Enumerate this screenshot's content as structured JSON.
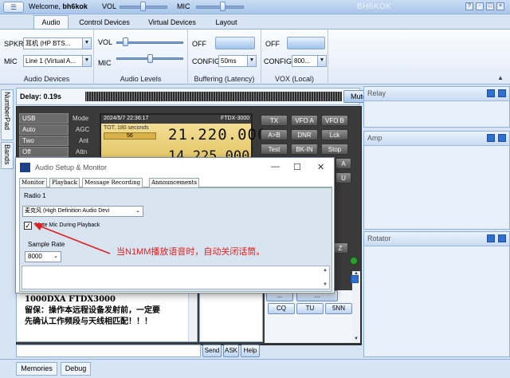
{
  "titlebar": {
    "menu_icon": "menu-icon",
    "welcome_prefix": "Welcome,",
    "user": "bh6kok",
    "vol_label": "VOL",
    "mic_label": "MIC",
    "app_title": "BH6KOK",
    "btn_help": "?",
    "btn_min": "-",
    "btn_max": "□",
    "btn_close": "×"
  },
  "tabs": [
    "Audio",
    "Control Devices",
    "Virtual Devices",
    "Layout"
  ],
  "ribbon": {
    "audio_devices": {
      "spkr_label": "SPKR",
      "spkr_value": "耳机 (HP BTS...",
      "mic_label": "MIC",
      "mic_value": "Line 1 (Virtual A...",
      "group": "Audio Devices"
    },
    "audio_levels": {
      "vol_label": "VOL",
      "mic_label": "MIC",
      "vol_level": 0.1,
      "mic_level": 0.5,
      "group": "Audio Levels"
    },
    "buffering": {
      "off_label": "OFF",
      "config_label": "CONFIG",
      "config_value": "50ms",
      "group": "Buffering (Latency)"
    },
    "vox": {
      "off_label": "OFF",
      "config_label": "CONFIG",
      "config_value": "800...",
      "group": "VOX (Local)"
    }
  },
  "sidebar": {
    "numberpad": "NumberPad",
    "bands": "Bands"
  },
  "delay": {
    "label": "Delay: 0.19s",
    "mute": "Mute"
  },
  "radio": {
    "left_buttons": [
      {
        "value": "USB",
        "label": "Mode"
      },
      {
        "value": "Auto",
        "label": "AGC"
      },
      {
        "value": "Two",
        "label": "Ant"
      },
      {
        "value": "Off",
        "label": "Attn"
      }
    ],
    "lcd": {
      "datetime": "2024/5/7 22:36:17",
      "model": "FTDX-3000",
      "tot": "TOT: 180 seconds",
      "tot_value": "56",
      "freq_main": "21.220.000",
      "freq_sub": "14.225.000"
    },
    "right_buttons": [
      [
        "TX",
        "VFO A",
        "VFO B"
      ],
      [
        "A>B",
        "DNR",
        "Lck"
      ],
      [
        "Test",
        "BK-IN",
        "Stop"
      ]
    ],
    "partial_right": [
      "A",
      "U"
    ],
    "z_label": "Z"
  },
  "bottom_text": {
    "line1": "1000DXA FTDX3000",
    "line2": "留保：操作本远程设备发射前，一定要",
    "line3": "先确认工作频段与天线相匹配！！！"
  },
  "cmd_buttons": {
    "partial_a": "...",
    "partial_b": "...",
    "cq": "CQ",
    "tu": "TU",
    "nn": "5NN"
  },
  "input_row": {
    "send": "Send",
    "ask": "ASK",
    "help": "Help"
  },
  "right_panels": [
    "Relay",
    "Amp",
    "Rotator"
  ],
  "bottom_tabs": [
    "Memories",
    "Debug"
  ],
  "dialog": {
    "title": "Audio Setup & Monitor",
    "min": "—",
    "max": "☐",
    "close": "✕",
    "tabs": [
      "Monitor",
      "Playback",
      "Message Recording",
      "Announcements"
    ],
    "radio_label": "Radio 1",
    "device_value": "麦克风 (High Definition Audio Devi",
    "checkbox_label": "Mute Mic During Playback",
    "checkbox_checked": true,
    "sample_rate_label": "Sample Rate",
    "sample_rate_value": "8000"
  },
  "annotation": "当N1MM播放语音时，自动关闭话筒。",
  "colors": {
    "annotation": "#e02020",
    "accent": "#2f6fd0",
    "lcd": "#f0d680"
  }
}
